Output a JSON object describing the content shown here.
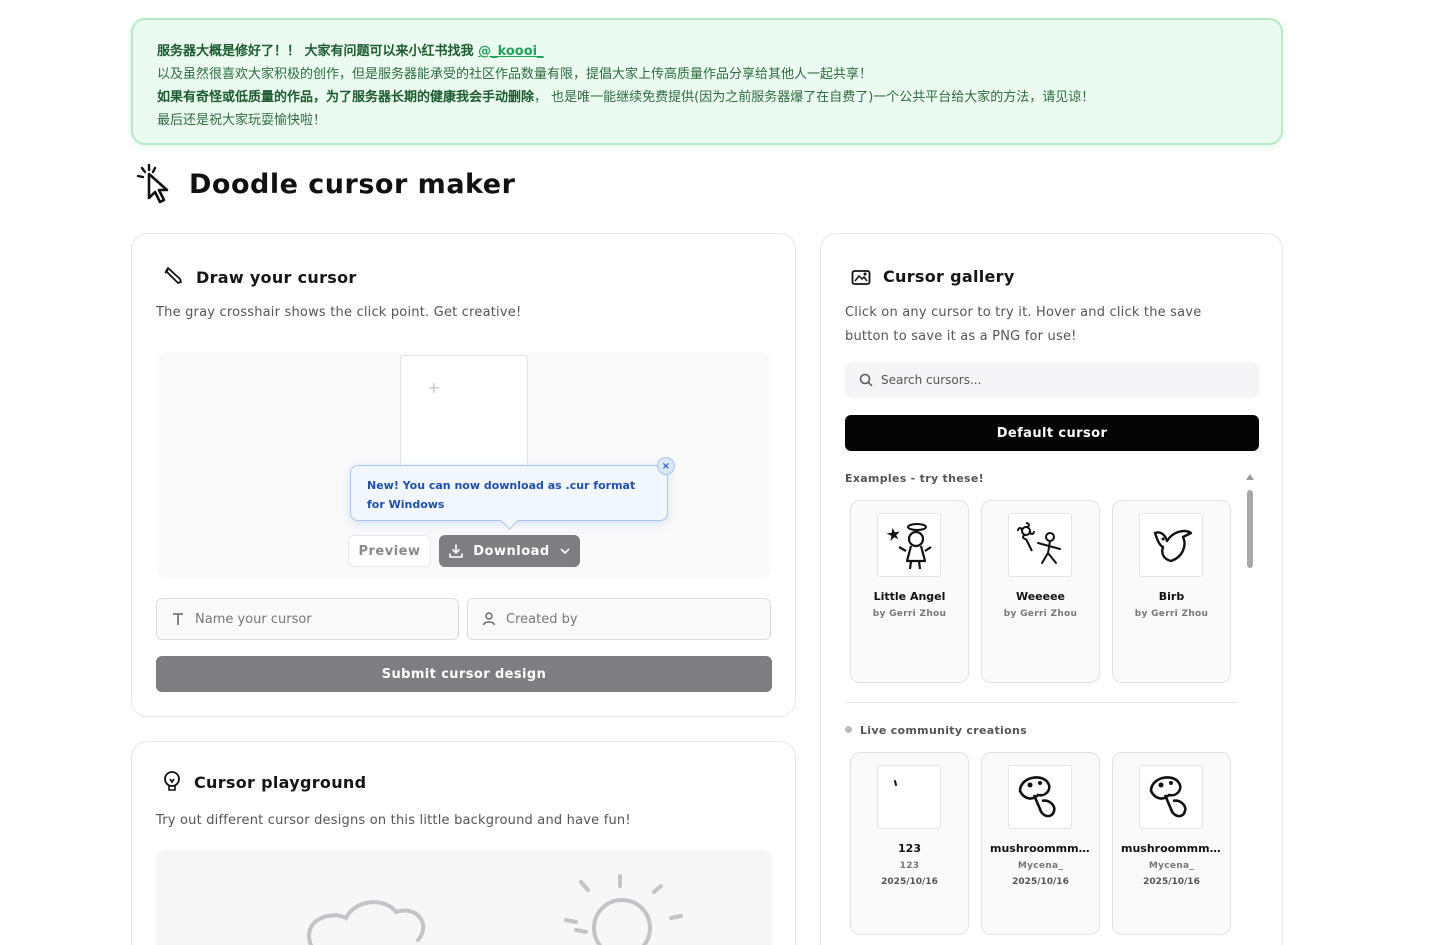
{
  "notice": {
    "line1": "服务器大概是修好了！！ 大家有问题可以来小红书找我",
    "handle": "@_koooi_",
    "line2": "以及虽然很喜欢大家积极的创作，但是服务器能承受的社区作品数量有限，提倡大家上传高质量作品分享给其他人一起共享！",
    "line3_bold": "如果有奇怪或低质量的作品，为了服务器长期的健康我会手动删除",
    "line3_rest": "， 也是唯一能继续免费提供(因为之前服务器爆了在自费了)一个公共平台给大家的方法，请见谅！",
    "line4": "最后还是祝大家玩耍愉快啦！"
  },
  "app": {
    "title": "Doodle cursor maker"
  },
  "draw": {
    "title": "Draw your cursor",
    "description": "The gray crosshair shows the click point. Get creative!",
    "tooltip": "New! You can now download as .cur format for Windows",
    "tooltip_close": "×",
    "preview_label": "Preview",
    "download_label": "Download",
    "name_placeholder": "Name your cursor",
    "creator_placeholder": "Created by",
    "submit_label": "Submit cursor design"
  },
  "playground": {
    "title": "Cursor playground",
    "description": "Try out different cursor designs on this little background and have fun!"
  },
  "gallery": {
    "title": "Cursor gallery",
    "description": "Click on any cursor to try it. Hover and click the save button to save it as a PNG for use!",
    "search_placeholder": "Search cursors...",
    "default_label": "Default cursor",
    "examples_label": "Examples - try these!",
    "examples": [
      {
        "name": "Little Angel",
        "author": "by Gerri Zhou",
        "icon": "angel-doodle-icon"
      },
      {
        "name": "Weeeee",
        "author": "by Gerri Zhou",
        "icon": "flower-stickman-doodle-icon"
      },
      {
        "name": "Birb",
        "author": "by Gerri Zhou",
        "icon": "bird-doodle-icon"
      }
    ],
    "live_label": "Live community creations",
    "community": [
      {
        "name": "123",
        "author": "123",
        "date": "2025/10/16",
        "icon": "dot-doodle-icon"
      },
      {
        "name": "mushroommm...",
        "author": "Mycena_",
        "date": "2025/10/16",
        "icon": "mushroom-doodle-icon"
      },
      {
        "name": "mushroommm...",
        "author": "Mycena_",
        "date": "2025/10/16",
        "icon": "mushroom-doodle-icon"
      }
    ]
  }
}
